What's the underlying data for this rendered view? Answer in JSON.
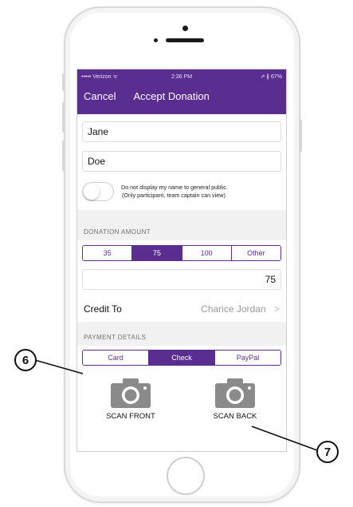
{
  "statusbar": {
    "carrier": "••••• Verizon ᯤ",
    "time": "2:36 PM",
    "battery": "⇗ ∦ 67%"
  },
  "navbar": {
    "cancel": "Cancel",
    "title": "Accept Donation"
  },
  "form": {
    "first_name": "Jane",
    "last_name": "Doe",
    "privacy_text_line1": "Do not display my name to general public.",
    "privacy_text_line2": "(Only participant, team captain can view)",
    "privacy_toggle_on": false
  },
  "donation": {
    "header": "DONATION AMOUNT",
    "options": [
      "35",
      "75",
      "100",
      "Other"
    ],
    "selected": "75",
    "amount_value": "75"
  },
  "credit": {
    "label": "Credit To",
    "value": "Charice Jordan",
    "chevron": ">"
  },
  "payment": {
    "header": "PAYMENT DETAILS",
    "options": [
      "Card",
      "Check",
      "PayPal"
    ],
    "selected": "Check"
  },
  "scan": {
    "front": "SCAN FRONT",
    "back": "SCAN BACK"
  },
  "callouts": {
    "six": "6",
    "seven": "7"
  },
  "colors": {
    "accent": "#5a2d91"
  }
}
